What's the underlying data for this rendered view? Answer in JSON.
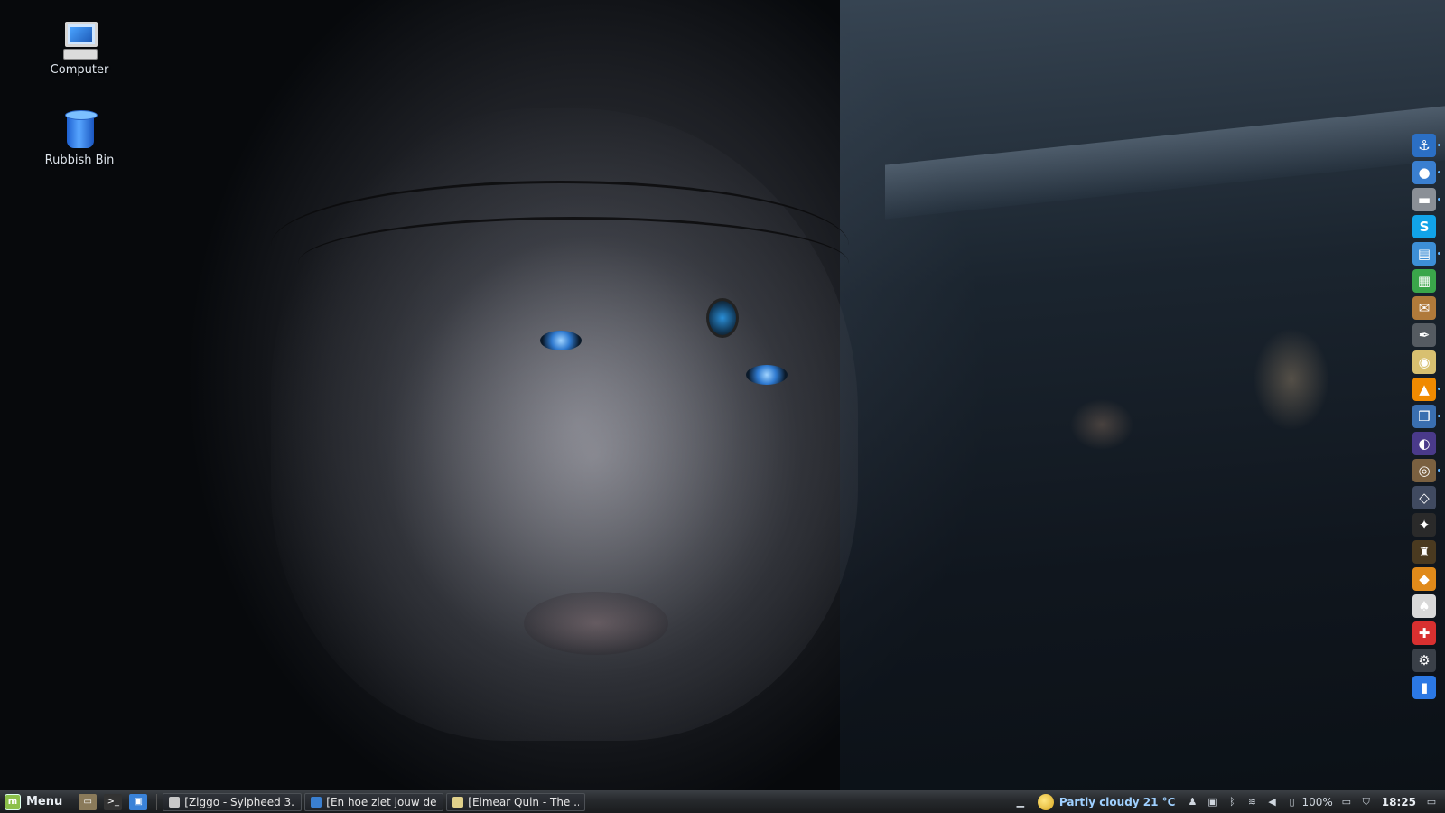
{
  "desktop": {
    "icons": [
      {
        "label": "Computer",
        "icon": "computer-icon"
      },
      {
        "label": "Rubbish Bin",
        "icon": "trash-icon"
      }
    ]
  },
  "dock": {
    "items": [
      {
        "icon": "anchor-icon",
        "glyph": "⚓",
        "color": "#2b6fc4"
      },
      {
        "icon": "globe-icon",
        "glyph": "●",
        "color": "#3a7fd0"
      },
      {
        "icon": "drive-icon",
        "glyph": "▬",
        "color": "#8a8f96"
      },
      {
        "icon": "skype-icon",
        "glyph": "S",
        "color": "#11a3e8"
      },
      {
        "icon": "writer-document-icon",
        "glyph": "▤",
        "color": "#3d8fd6"
      },
      {
        "icon": "spreadsheet-icon",
        "glyph": "▦",
        "color": "#3aa64a"
      },
      {
        "icon": "mail-client-icon",
        "glyph": "✉",
        "color": "#b07a3a"
      },
      {
        "icon": "inkscape-icon",
        "glyph": "✒",
        "color": "#555b61"
      },
      {
        "icon": "audio-player-icon",
        "glyph": "◉",
        "color": "#d8c070"
      },
      {
        "icon": "vlc-icon",
        "glyph": "▲",
        "color": "#f08a00"
      },
      {
        "icon": "virtualbox-icon",
        "glyph": "❒",
        "color": "#3a6fb0"
      },
      {
        "icon": "stellarium-icon",
        "glyph": "◐",
        "color": "#4a3a8a"
      },
      {
        "icon": "game-icon",
        "glyph": "◎",
        "color": "#7a6040"
      },
      {
        "icon": "halo-game-icon",
        "glyph": "◇",
        "color": "#404a60"
      },
      {
        "icon": "starcraft-icon",
        "glyph": "✦",
        "color": "#2a2a2a"
      },
      {
        "icon": "warcraft-icon",
        "glyph": "♜",
        "color": "#4a3a20"
      },
      {
        "icon": "gem-icon",
        "glyph": "◆",
        "color": "#e08a1a"
      },
      {
        "icon": "cards-icon",
        "glyph": "♠",
        "color": "#d8d8d8"
      },
      {
        "icon": "lifebuoy-icon",
        "glyph": "✚",
        "color": "#d83030"
      },
      {
        "icon": "steam-icon",
        "glyph": "⚙",
        "color": "#3a4048"
      },
      {
        "icon": "trash-icon",
        "glyph": "▮",
        "color": "#2b78e4"
      }
    ]
  },
  "panel": {
    "menu_label": "Menu",
    "launchers": [
      {
        "icon": "file-manager-icon",
        "glyph": "▭",
        "color": "#8a7a5a"
      },
      {
        "icon": "terminal-icon",
        "glyph": ">_",
        "color": "#333"
      },
      {
        "icon": "show-desktop-icon",
        "glyph": "▣",
        "color": "#3a82d8"
      }
    ],
    "windows": [
      {
        "title": "[Ziggo - Sylpheed 3....",
        "icon": "mail-icon",
        "color": "#c8c8c8"
      },
      {
        "title": "[En hoe ziet jouw de...",
        "icon": "browser-icon",
        "color": "#3a7fd0"
      },
      {
        "title": "[Eimear Quin - The ...",
        "icon": "audio-icon",
        "color": "#e0d08a"
      }
    ],
    "tray": {
      "weather": "Partly cloudy 21 °C",
      "battery": "100%",
      "clock": "18:25"
    }
  }
}
